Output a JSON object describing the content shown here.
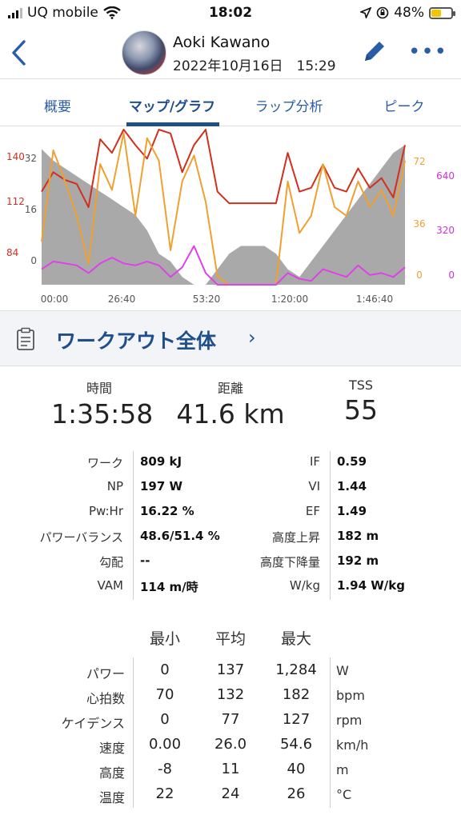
{
  "status": {
    "carrier": "UQ mobile",
    "time": "18:02",
    "battery": "48%",
    "battery_level": 0.48
  },
  "header": {
    "name": "Aoki Kawano",
    "date": "2022年10月16日　15:29"
  },
  "tabs": [
    {
      "label": "概要"
    },
    {
      "label": "マップ/グラフ"
    },
    {
      "label": "ラップ分析"
    },
    {
      "label": "ピーク"
    }
  ],
  "chart_data": {
    "type": "line",
    "x_ticks": [
      "00:00",
      "26:40",
      "53:20",
      "1:20:00",
      "1:46:40"
    ],
    "hr_axis_labels": [
      "140",
      "112",
      "84"
    ],
    "speed_axis_labels": [
      "32",
      "16",
      "0"
    ],
    "cadence_axis_labels": [
      "72",
      "36",
      "0"
    ],
    "power_axis_labels": [
      "640",
      "320",
      "0"
    ],
    "colors": {
      "hr": "#d0301e",
      "cadence": "#f0a030",
      "power": "#e040e8",
      "elevation": "#9a9a9a",
      "hr_axis": "#d0301e",
      "speed_axis": "#555555",
      "cadence_axis": "#f0a030",
      "power_axis": "#d030d8"
    },
    "series": [
      {
        "values": [
          118,
          128,
          124,
          122,
          110,
          145,
          138,
          150,
          142,
          135,
          150,
          148,
          128,
          142,
          150,
          118,
          112,
          112,
          112,
          112,
          112,
          138,
          118,
          120,
          132,
          120,
          118,
          130,
          120,
          125,
          115,
          142
        ]
      },
      {
        "values": [
          25,
          78,
          60,
          40,
          12,
          70,
          55,
          88,
          40,
          85,
          72,
          20,
          60,
          75,
          48,
          5,
          0,
          0,
          0,
          0,
          0,
          60,
          30,
          40,
          70,
          45,
          40,
          60,
          45,
          55,
          40,
          72
        ]
      },
      {
        "values": [
          80,
          120,
          110,
          100,
          60,
          110,
          140,
          110,
          100,
          120,
          100,
          40,
          90,
          200,
          60,
          0,
          0,
          0,
          0,
          0,
          0,
          60,
          30,
          20,
          80,
          60,
          40,
          100,
          50,
          60,
          40,
          90
        ]
      }
    ],
    "elevation_values": [
      35,
      32,
      30,
      28,
      26,
      24,
      22,
      20,
      18,
      14,
      8,
      6,
      2,
      0,
      0,
      4,
      8,
      10,
      10,
      10,
      8,
      4,
      2,
      6,
      10,
      14,
      18,
      22,
      26,
      30,
      34,
      36
    ]
  },
  "section": {
    "title": "ワークアウト全体"
  },
  "summary": [
    {
      "label": "時間",
      "value": "1:35:58"
    },
    {
      "label": "距離",
      "value": "41.6 km"
    },
    {
      "label": "TSS",
      "value": "55"
    }
  ],
  "metrics": [
    {
      "l1": "ワーク",
      "v1": "809 kJ",
      "l2": "IF",
      "v2": "0.59"
    },
    {
      "l1": "NP",
      "v1": "197 W",
      "l2": "VI",
      "v2": "1.44"
    },
    {
      "l1": "Pw:Hr",
      "v1": "16.22 %",
      "l2": "EF",
      "v2": "1.49"
    },
    {
      "l1": "パワーバランス",
      "v1": "48.6/51.4 %",
      "l2": "高度上昇",
      "v2": "182 m"
    },
    {
      "l1": "勾配",
      "v1": "--",
      "l2": "高度下降量",
      "v2": "192 m"
    },
    {
      "l1": "VAM",
      "v1": "114 m/時",
      "l2": "W/kg",
      "v2": "1.94 W/kg"
    }
  ],
  "stats_header": [
    "最小",
    "平均",
    "最大"
  ],
  "stats": [
    {
      "label": "パワー",
      "min": "0",
      "avg": "137",
      "max": "1,284",
      "unit": "W"
    },
    {
      "label": "心拍数",
      "min": "70",
      "avg": "132",
      "max": "182",
      "unit": "bpm"
    },
    {
      "label": "ケイデンス",
      "min": "0",
      "avg": "77",
      "max": "127",
      "unit": "rpm"
    },
    {
      "label": "速度",
      "min": "0.00",
      "avg": "26.0",
      "max": "54.6",
      "unit": "km/h"
    },
    {
      "label": "高度",
      "min": "-8",
      "avg": "11",
      "max": "40",
      "unit": "m"
    },
    {
      "label": "温度",
      "min": "22",
      "avg": "24",
      "max": "26",
      "unit": "°C"
    }
  ]
}
